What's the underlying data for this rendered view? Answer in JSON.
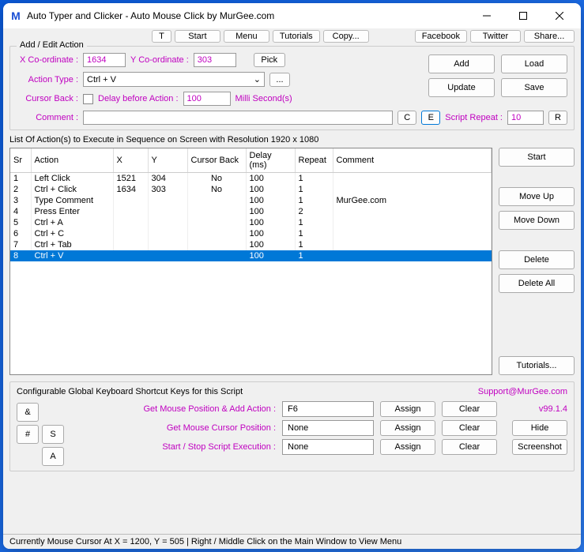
{
  "window": {
    "title": "Auto Typer and Clicker - Auto Mouse Click by MurGee.com",
    "icon_letter": "M"
  },
  "toolbar": {
    "t": "T",
    "start": "Start",
    "menu": "Menu",
    "tutorials": "Tutorials",
    "copy": "Copy...",
    "facebook": "Facebook",
    "twitter": "Twitter",
    "share": "Share..."
  },
  "edit": {
    "group_title": "Add / Edit Action",
    "x_label": "X Co-ordinate :",
    "x_value": "1634",
    "y_label": "Y Co-ordinate :",
    "y_value": "303",
    "pick": "Pick",
    "action_type_label": "Action Type :",
    "action_type_value": "Ctrl + V",
    "dots": "...",
    "cursor_back_label": "Cursor Back :",
    "delay_label": "Delay before Action :",
    "delay_value": "100",
    "milli": "Milli Second(s)",
    "comment_label": "Comment :",
    "c_btn": "C",
    "e_btn": "E",
    "script_repeat_label": "Script Repeat :",
    "script_repeat_value": "10",
    "r_btn": "R",
    "add": "Add",
    "load": "Load",
    "update": "Update",
    "save": "Save"
  },
  "list": {
    "caption": "List Of Action(s) to Execute in Sequence on Screen with Resolution 1920 x 1080",
    "headers": {
      "sr": "Sr",
      "action": "Action",
      "x": "X",
      "y": "Y",
      "cb": "Cursor Back",
      "delay": "Delay (ms)",
      "repeat": "Repeat",
      "comment": "Comment"
    },
    "rows": [
      {
        "sr": "1",
        "action": "Left Click",
        "x": "1521",
        "y": "304",
        "cb": "No",
        "delay": "100",
        "repeat": "1",
        "comment": ""
      },
      {
        "sr": "2",
        "action": "Ctrl + Click",
        "x": "1634",
        "y": "303",
        "cb": "No",
        "delay": "100",
        "repeat": "1",
        "comment": ""
      },
      {
        "sr": "3",
        "action": "Type Comment",
        "x": "",
        "y": "",
        "cb": "",
        "delay": "100",
        "repeat": "1",
        "comment": "MurGee.com"
      },
      {
        "sr": "4",
        "action": "Press Enter",
        "x": "",
        "y": "",
        "cb": "",
        "delay": "100",
        "repeat": "2",
        "comment": ""
      },
      {
        "sr": "5",
        "action": "Ctrl + A",
        "x": "",
        "y": "",
        "cb": "",
        "delay": "100",
        "repeat": "1",
        "comment": ""
      },
      {
        "sr": "6",
        "action": "Ctrl + C",
        "x": "",
        "y": "",
        "cb": "",
        "delay": "100",
        "repeat": "1",
        "comment": ""
      },
      {
        "sr": "7",
        "action": "Ctrl + Tab",
        "x": "",
        "y": "",
        "cb": "",
        "delay": "100",
        "repeat": "1",
        "comment": ""
      },
      {
        "sr": "8",
        "action": "Ctrl + V",
        "x": "",
        "y": "",
        "cb": "",
        "delay": "100",
        "repeat": "1",
        "comment": "",
        "selected": true
      }
    ],
    "side": {
      "start": "Start",
      "move_up": "Move Up",
      "move_down": "Move Down",
      "delete": "Delete",
      "delete_all": "Delete All",
      "tutorials": "Tutorials..."
    }
  },
  "shortcuts": {
    "title": "Configurable Global Keyboard Shortcut Keys for this Script",
    "support": "Support@MurGee.com",
    "version": "v99.1.4",
    "row1_label": "Get Mouse Position & Add Action :",
    "row1_value": "F6",
    "row2_label": "Get Mouse Cursor Position :",
    "row2_value": "None",
    "row3_label": "Start / Stop Script Execution :",
    "row3_value": "None",
    "assign": "Assign",
    "clear": "Clear",
    "hide": "Hide",
    "screenshot": "Screenshot",
    "amp": "&",
    "hash": "#",
    "s": "S",
    "a": "A"
  },
  "status": "Currently Mouse Cursor At X = 1200, Y = 505 | Right / Middle Click on the Main Window to View Menu"
}
